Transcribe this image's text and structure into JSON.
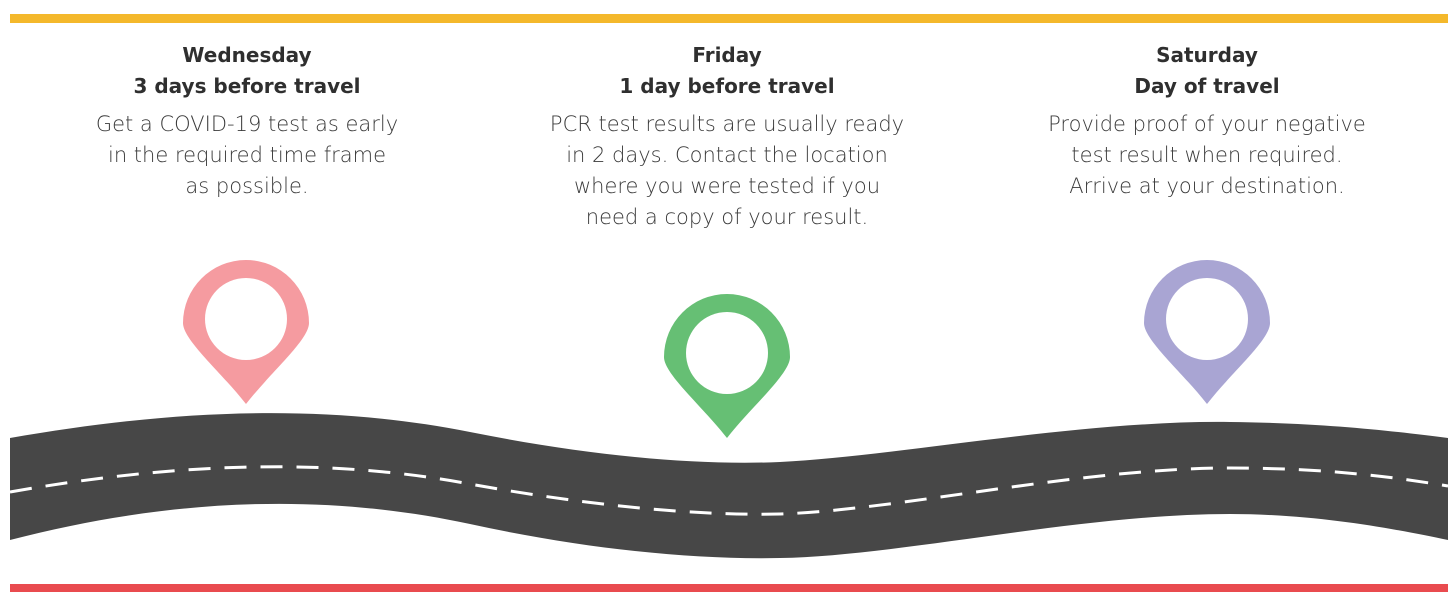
{
  "colors": {
    "top_bar": "#f4b82b",
    "bottom_bar": "#e94b4f",
    "road": "#474747",
    "road_dash": "#ffffff",
    "pin_1": "#f59ba0",
    "pin_2": "#66bf74",
    "pin_3": "#a9a5d3"
  },
  "steps": [
    {
      "day": "Wednesday",
      "when": "3 days before travel",
      "text_lines": [
        "Get a COVID-19 test as early",
        "in the required time frame",
        "as possible."
      ],
      "icon": "location-pin-icon"
    },
    {
      "day": "Friday",
      "when": "1 day before travel",
      "text_lines": [
        "PCR test results are usually ready",
        "in 2 days. Contact the location",
        "where you were tested if you",
        "need a copy of your result."
      ],
      "icon": "location-pin-icon"
    },
    {
      "day": "Saturday",
      "when": "Day of travel",
      "text_lines": [
        "Provide proof of your negative",
        "test result when required.",
        "Arrive at your destination."
      ],
      "icon": "location-pin-icon"
    }
  ]
}
